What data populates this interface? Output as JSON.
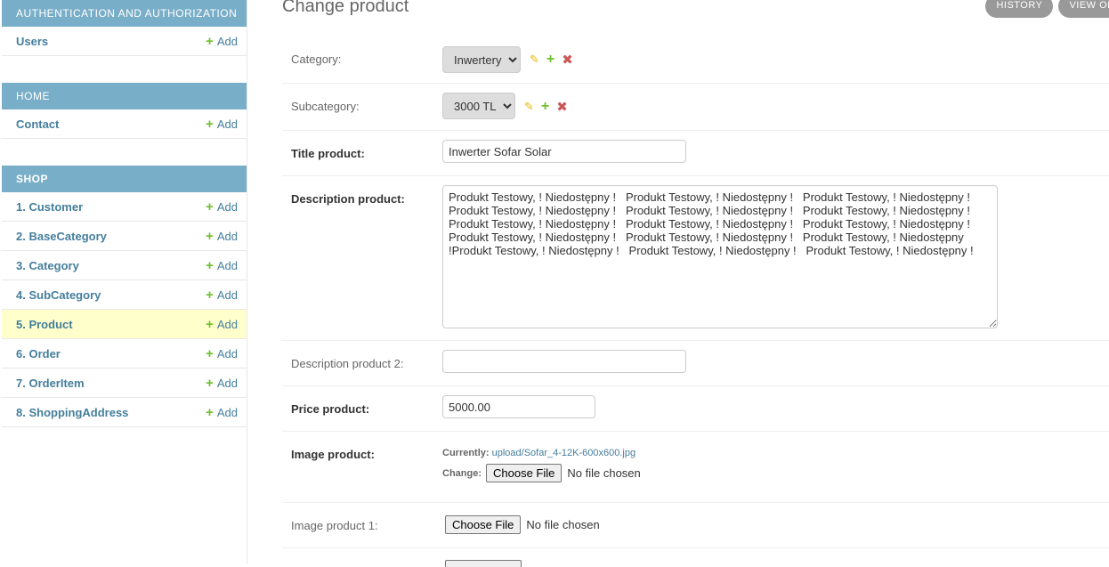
{
  "sidebar": {
    "auth": {
      "caption": "Authentication and Authorization",
      "rows": [
        {
          "label": "Users",
          "add": "Add"
        }
      ]
    },
    "home": {
      "caption": "Home",
      "rows": [
        {
          "label": "Contact",
          "add": "Add"
        }
      ]
    },
    "shop": {
      "caption": "Shop",
      "rows": [
        {
          "label": "1. Customer",
          "add": "Add"
        },
        {
          "label": "2. BaseCategory",
          "add": "Add"
        },
        {
          "label": "3. Category",
          "add": "Add"
        },
        {
          "label": "4. SubCategory",
          "add": "Add"
        },
        {
          "label": "5. Product",
          "add": "Add"
        },
        {
          "label": "6. Order",
          "add": "Add"
        },
        {
          "label": "7. OrderItem",
          "add": "Add"
        },
        {
          "label": "8. ShoppingAddress",
          "add": "Add"
        }
      ]
    }
  },
  "page": {
    "title": "Change product",
    "tools": {
      "history": "History",
      "view_on_site": "View on s"
    }
  },
  "form": {
    "category": {
      "label": "Category:",
      "value": "Inwertery"
    },
    "subcategory": {
      "label": "Subcategory:",
      "value": "3000 TL"
    },
    "title": {
      "label": "Title product:",
      "value": "Inwerter Sofar Solar"
    },
    "description": {
      "label": "Description product:",
      "value": "Produkt Testowy, ! Niedostępny !   Produkt Testowy, ! Niedostępny !   Produkt Testowy, ! Niedostępny !\nProdukt Testowy, ! Niedostępny !   Produkt Testowy, ! Niedostępny !   Produkt Testowy, ! Niedostępny !\nProdukt Testowy, ! Niedostępny !   Produkt Testowy, ! Niedostępny !   Produkt Testowy, ! Niedostępny !\nProdukt Testowy, ! Niedostępny !   Produkt Testowy, ! Niedostępny !   Produkt Testowy, ! Niedostępny\n!Produkt Testowy, ! Niedostępny !   Produkt Testowy, ! Niedostępny !   Produkt Testowy, ! Niedostępny !"
    },
    "description2": {
      "label": "Description product 2:",
      "value": ""
    },
    "price": {
      "label": "Price product:",
      "value": "5000.00"
    },
    "image": {
      "label": "Image product:",
      "currently_label": "Currently:",
      "currently_value": "upload/Sofar_4-12K-600x600.jpg",
      "change_label": "Change:",
      "button": "Choose File",
      "status": "No file chosen"
    },
    "image1": {
      "label": "Image product 1:",
      "button": "Choose File",
      "status": "No file chosen"
    }
  },
  "colors": {
    "module_caption": "#79aec8",
    "link": "#447e9b",
    "add_icon": "#70bf2b",
    "current_row": "#ffffcc",
    "tool_button": "#999999"
  },
  "icons": {
    "add": "plus-icon",
    "edit": "pencil-icon",
    "delete": "x-icon"
  }
}
